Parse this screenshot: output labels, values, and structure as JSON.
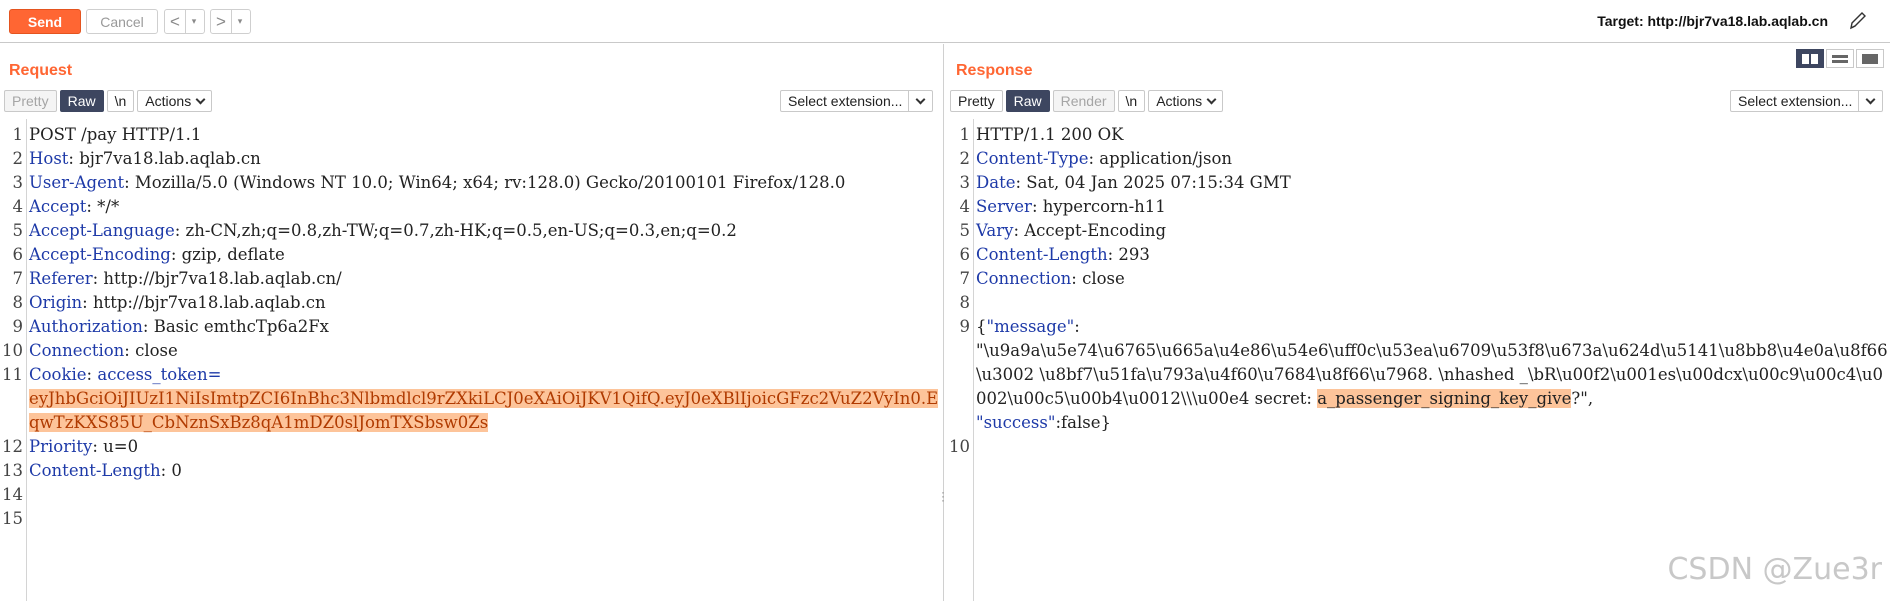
{
  "toolbar": {
    "send_label": "Send",
    "cancel_label": "Cancel",
    "back_arrow": "<",
    "forward_arrow": ">",
    "dropdown_glyph": "▾",
    "target_label": "Target: http://bjr7va18.lab.aqlab.cn"
  },
  "request": {
    "title": "Request",
    "tabs": [
      "Pretty",
      "Raw",
      "\\n"
    ],
    "active_tab": "Raw",
    "actions_label": "Actions",
    "extension_label": "Select extension...",
    "lines": [
      {
        "n": "1",
        "name": "",
        "value": "POST /pay HTTP/1.1"
      },
      {
        "n": "2",
        "name": "Host",
        "value": " bjr7va18.lab.aqlab.cn"
      },
      {
        "n": "3",
        "name": "User-Agent",
        "value": " Mozilla/5.0 (Windows NT 10.0; Win64; x64; rv:128.0) Gecko/20100101 Firefox/128.0"
      },
      {
        "n": "4",
        "name": "Accept",
        "value": " */*"
      },
      {
        "n": "5",
        "name": "Accept-Language",
        "value": " zh-CN,zh;q=0.8,zh-TW;q=0.7,zh-HK;q=0.5,en-US;q=0.3,en;q=0.2"
      },
      {
        "n": "6",
        "name": "Accept-Encoding",
        "value": " gzip, deflate"
      },
      {
        "n": "7",
        "name": "Referer",
        "value": " http://bjr7va18.lab.aqlab.cn/"
      },
      {
        "n": "8",
        "name": "Origin",
        "value": " http://bjr7va18.lab.aqlab.cn"
      },
      {
        "n": "9",
        "name": "Authorization",
        "value": " Basic emthcTp6a2Fx"
      },
      {
        "n": "10",
        "name": "Connection",
        "value": " close"
      },
      {
        "n": "11",
        "name": "Cookie",
        "value": " access_token=",
        "highlight": "eyJhbGciOiJIUzI1NiIsImtpZCI6InBhc3Nlbmdlcl9rZXkiLCJ0eXAiOiJKV1QifQ.eyJ0eXBlIjoicGFzc2VuZ2VyIn0.EqwTzKXS85U_CbNznSxBz8qA1mDZ0slJomTXSbsw0Zs"
      },
      {
        "n": "12",
        "name": "Priority",
        "value": " u=0"
      },
      {
        "n": "13",
        "name": "Content-Length",
        "value": " 0"
      },
      {
        "n": "14",
        "name": "",
        "value": ""
      },
      {
        "n": "15",
        "name": "",
        "value": ""
      }
    ]
  },
  "response": {
    "title": "Response",
    "tabs": [
      "Pretty",
      "Raw",
      "Render",
      "\\n"
    ],
    "active_tab": "Raw",
    "actions_label": "Actions",
    "extension_label": "Select extension...",
    "lines": [
      {
        "n": "1",
        "name": "",
        "value": "HTTP/1.1 200 OK"
      },
      {
        "n": "2",
        "name": "Content-Type",
        "value": " application/json"
      },
      {
        "n": "3",
        "name": "Date",
        "value": " Sat, 04 Jan 2025 07:15:34 GMT"
      },
      {
        "n": "4",
        "name": "Server",
        "value": " hypercorn-h11"
      },
      {
        "n": "5",
        "name": "Vary",
        "value": " Accept-Encoding"
      },
      {
        "n": "6",
        "name": "Content-Length",
        "value": " 293"
      },
      {
        "n": "7",
        "name": "Connection",
        "value": " close"
      },
      {
        "n": "8",
        "name": "",
        "value": ""
      }
    ],
    "json_line": {
      "n": "9",
      "open_brace": "{",
      "message_key": "\"message\"",
      "colon": ":",
      "message_value": "\"\\u9a9a\\u5e74\\u6765\\u665a\\u4e86\\u54e6\\uff0c\\u53ea\\u6709\\u53f8\\u673a\\u624d\\u5141\\u8bb8\\u4e0a\\u8f66\\u3002 \\u8bf7\\u51fa\\u793a\\u4f60\\u7684\\u8f66\\u7968. \\nhashed _\\bR\\u00f2\\u001es\\u00dcx\\u00c9\\u00c4\\u0002\\u00c5\\u00b4\\u0012\\\\\\u00e4 secret: ",
      "secret_highlight": "a_passenger_signing_key_give",
      "message_tail": "?\",",
      "success_key": "\"success\"",
      "success_value": "false",
      "close_brace": "}"
    },
    "last_line_n": "10"
  },
  "watermark": "CSDN @Zue3r",
  "colors": {
    "accent": "#ff6633",
    "header_name": "#1e3aa8",
    "highlight_bg": "#fdc49a",
    "active_tab": "#3d4660"
  }
}
